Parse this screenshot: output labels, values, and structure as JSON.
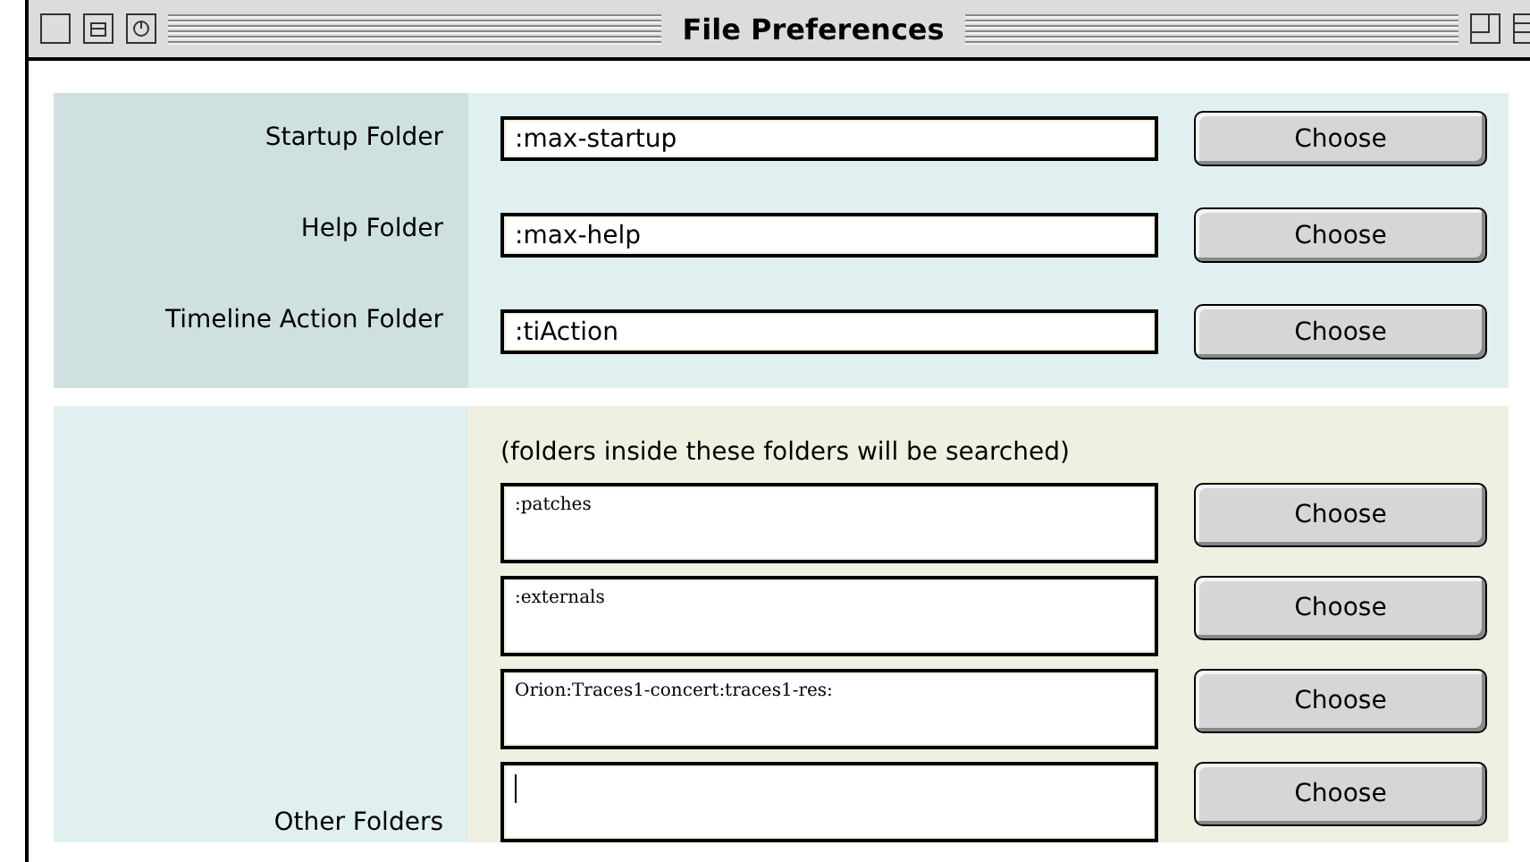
{
  "window": {
    "title": "File Preferences"
  },
  "folders": [
    {
      "label": "Startup Folder",
      "value": ":max-startup",
      "button": "Choose"
    },
    {
      "label": "Help Folder",
      "value": ":max-help",
      "button": "Choose"
    },
    {
      "label": "Timeline Action Folder",
      "value": ":tiAction",
      "button": "Choose"
    }
  ],
  "other_folders": {
    "label": "Other Folders",
    "note": "(folders inside these folders will be searched)",
    "rows": [
      {
        "value": ":patches",
        "button": "Choose",
        "focused": false
      },
      {
        "value": ":externals",
        "button": "Choose",
        "focused": false
      },
      {
        "value": "Orion:Traces1-concert:traces1-res:",
        "button": "Choose",
        "focused": false
      },
      {
        "value": "",
        "button": "Choose",
        "focused": true
      }
    ]
  }
}
